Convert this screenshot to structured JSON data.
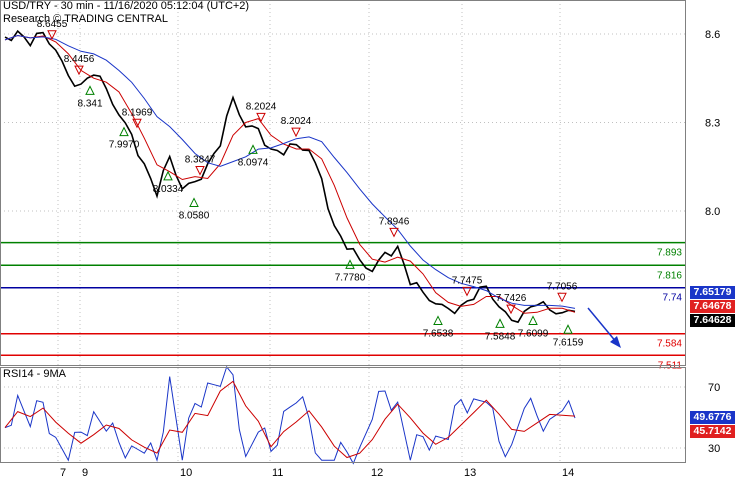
{
  "header": {
    "symbol_line": "USD/TRY - 30 min - 11/16/2020 05:12:04 (UTC+2)",
    "research_line": "Research © TRADING CENTRAL"
  },
  "price_axis": {
    "ticks": [
      "8.6",
      "8.3",
      "8.0"
    ]
  },
  "date_axis": {
    "ticks": [
      "7",
      "9",
      "10",
      "11",
      "12",
      "13",
      "14"
    ]
  },
  "indicator": {
    "label": "RSI14 - 9MA",
    "ticks": [
      "70",
      "30"
    ]
  },
  "levels": [
    {
      "label": "7.893",
      "value": 7.893,
      "color": "#008000"
    },
    {
      "label": "7.816",
      "value": 7.816,
      "color": "#008000"
    },
    {
      "label": "7.74",
      "value": 7.74,
      "color": "#0000a0"
    },
    {
      "label": "7.584",
      "value": 7.584,
      "color": "#e00000"
    },
    {
      "label": "7.511",
      "value": 7.511,
      "color": "#e00000"
    }
  ],
  "badges": [
    {
      "label": "7.65179",
      "color": "#1a35c8"
    },
    {
      "label": "7.64678",
      "color": "#e02020"
    },
    {
      "label": "7.64628",
      "color": "#000000"
    },
    {
      "label": "49.6776",
      "color": "#1a35c8"
    },
    {
      "label": "45.7142",
      "color": "#e02020"
    }
  ],
  "annotations": [
    {
      "label": "8.6455",
      "kind": "high"
    },
    {
      "label": "8.4456",
      "kind": "high"
    },
    {
      "label": "8.341",
      "kind": "low"
    },
    {
      "label": "8.1969",
      "kind": "high"
    },
    {
      "label": "7.9970",
      "kind": "low"
    },
    {
      "label": "8.0334",
      "kind": "low"
    },
    {
      "label": "8.0580",
      "kind": "low"
    },
    {
      "label": "8.3847",
      "kind": "high"
    },
    {
      "label": "8.2024",
      "kind": "high"
    },
    {
      "label": "8.2024",
      "kind": "high"
    },
    {
      "label": "8.0974",
      "kind": "low"
    },
    {
      "label": "7.8946",
      "kind": "high"
    },
    {
      "label": "7.7780",
      "kind": "low"
    },
    {
      "label": "7.7475",
      "kind": "high"
    },
    {
      "label": "7.7426",
      "kind": "high"
    },
    {
      "label": "7.7056",
      "kind": "high"
    },
    {
      "label": "7.6538",
      "kind": "low"
    },
    {
      "label": "7.5848",
      "kind": "low"
    },
    {
      "label": "7.6099",
      "kind": "low"
    },
    {
      "label": "7.6159",
      "kind": "low"
    }
  ],
  "colors": {
    "grid": "#c0c0c0",
    "price": "#000000",
    "ma_fast": "#cc0000",
    "ma_slow": "#1a35c8",
    "arrow": "#1a35c8"
  },
  "chart_data": {
    "type": "line",
    "series": [
      {
        "name": "",
        "values": [
          8.58,
          8.61,
          8.57,
          8.6,
          8.55,
          8.45,
          8.43,
          8.47,
          8.41,
          8.33,
          8.25,
          8.16,
          8.06,
          8.18,
          8.08,
          8.09,
          8.16,
          8.23,
          8.38,
          8.29,
          8.27,
          8.21,
          8.2,
          8.22,
          8.21,
          8.1,
          7.95,
          7.88,
          7.83,
          7.8,
          7.85,
          7.88,
          7.76,
          7.72,
          7.69,
          7.66,
          7.68,
          7.71,
          7.74,
          7.68,
          7.62,
          7.66,
          7.69,
          7.66,
          7.66,
          7.65
        ]
      }
    ],
    "y_ticks": [
      8.6,
      8.3,
      8.0
    ],
    "rsi_ticks": [
      70,
      30
    ]
  }
}
